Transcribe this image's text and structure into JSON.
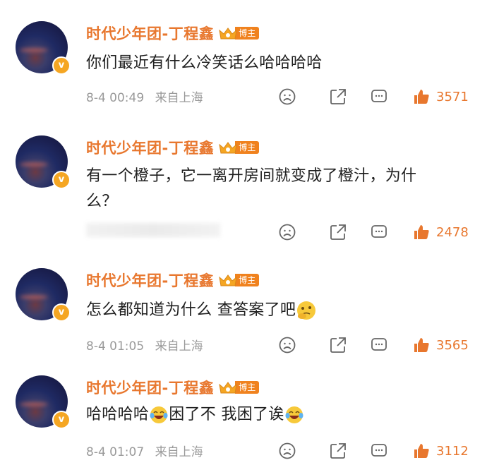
{
  "comments": [
    {
      "username": "时代少年团-丁程鑫",
      "badge": "博主",
      "lines": [
        "你们最近有什么冷笑话么哈哈哈哈"
      ],
      "date": "8-4 00:49",
      "source": "来自上海",
      "likes": "3571"
    },
    {
      "username": "时代少年团-丁程鑫",
      "badge": "博主",
      "lines": [
        "有一个橙子，它一离开房间就变成了橙汁，为什",
        "么？"
      ],
      "date": "",
      "source": "",
      "likes": "2478"
    },
    {
      "username": "时代少年团-丁程鑫",
      "badge": "博主",
      "text_a": "怎么都知道为什么 查答案了吧",
      "date": "8-4 01:05",
      "source": "来自上海",
      "likes": "3565"
    },
    {
      "username": "时代少年团-丁程鑫",
      "badge": "博主",
      "text_a": "哈哈哈哈",
      "text_b": "困了不 我困了诶",
      "date": "8-4 01:07",
      "source": "来自上海",
      "likes": "3112"
    }
  ],
  "verified_mark": "v",
  "colors": {
    "accent": "#e8772e",
    "meta": "#9a9a9a",
    "text": "#1f1f1f"
  },
  "icons": [
    "sad-face-icon",
    "share-icon",
    "comment-icon",
    "thumbs-up-icon"
  ]
}
